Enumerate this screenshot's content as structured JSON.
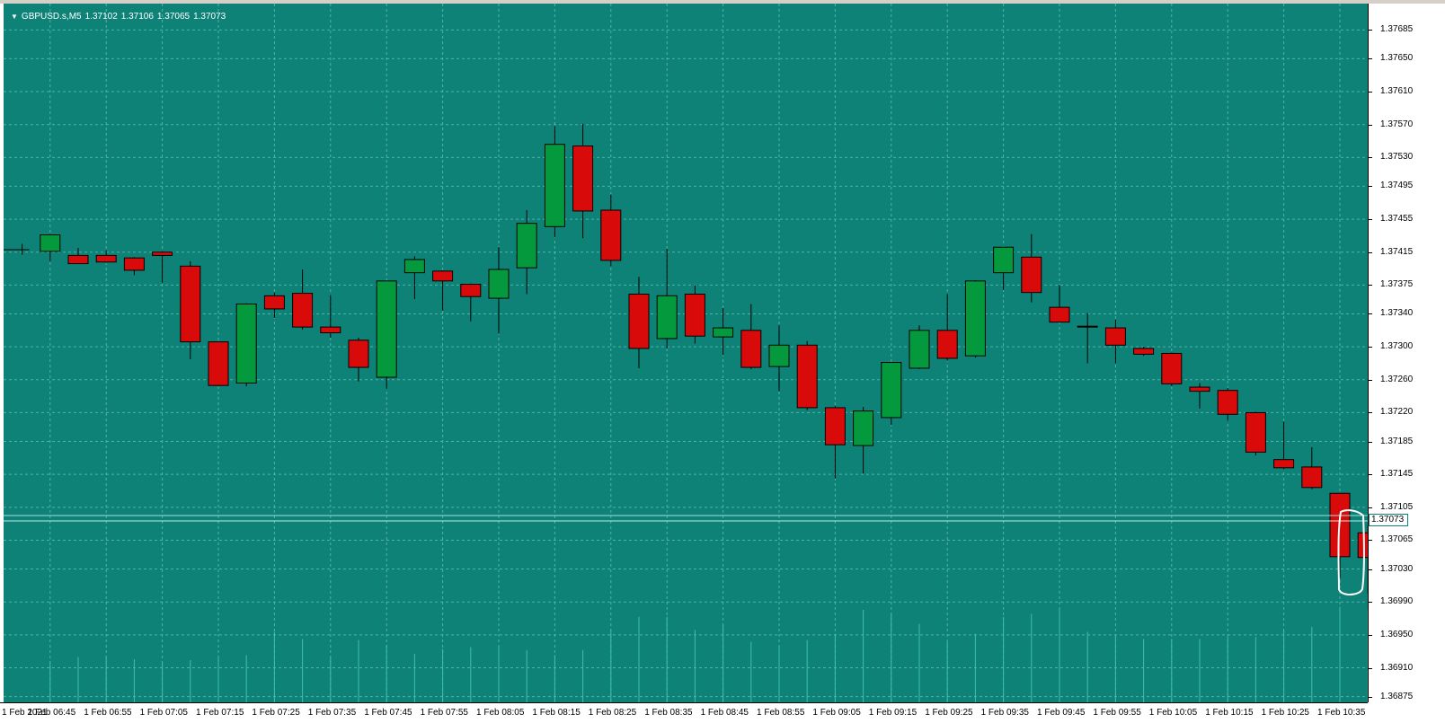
{
  "symbol_info": {
    "symbol": "GBPUSD.s,M5",
    "open": "1.37102",
    "high": "1.37106",
    "low": "1.37065",
    "close": "1.37073"
  },
  "current_price_label": "1.37073",
  "colors": {
    "background": "#0f8278",
    "bull": "#05993d",
    "bear": "#d80a0a",
    "grid": "#4fb3a8",
    "volume": "#3dbfb0"
  },
  "chart_data": {
    "type": "candlestick",
    "price_axis": [
      "1.37685",
      "1.37650",
      "1.37610",
      "1.37570",
      "1.37530",
      "1.37495",
      "1.37455",
      "1.37415",
      "1.37375",
      "1.37340",
      "1.37300",
      "1.37260",
      "1.37220",
      "1.37185",
      "1.37145",
      "1.37105",
      "1.37065",
      "1.37030",
      "1.36990",
      "1.36950",
      "1.36910",
      "1.36875"
    ],
    "time_axis": [
      "1 Feb 2021",
      "1 Feb 06:45",
      "1 Feb 06:55",
      "1 Feb 07:05",
      "1 Feb 07:15",
      "1 Feb 07:25",
      "1 Feb 07:35",
      "1 Feb 07:45",
      "1 Feb 07:55",
      "1 Feb 08:05",
      "1 Feb 08:15",
      "1 Feb 08:25",
      "1 Feb 08:35",
      "1 Feb 08:45",
      "1 Feb 08:55",
      "1 Feb 09:05",
      "1 Feb 09:15",
      "1 Feb 09:25",
      "1 Feb 09:35",
      "1 Feb 09:45",
      "1 Feb 09:55",
      "1 Feb 10:05",
      "1 Feb 10:15",
      "1 Feb 10:25",
      "1 Feb 10:35"
    ],
    "ylim": [
      1.36868,
      1.37717
    ],
    "timeframe": "M5",
    "candles": [
      {
        "o": 1.37418,
        "h": 1.37425,
        "l": 1.37412,
        "c": 1.37418
      },
      {
        "o": 1.37416,
        "h": 1.37437,
        "l": 1.37404,
        "c": 1.37436
      },
      {
        "o": 1.37411,
        "h": 1.3742,
        "l": 1.37402,
        "c": 1.37401
      },
      {
        "o": 1.37411,
        "h": 1.37417,
        "l": 1.37402,
        "c": 1.37403
      },
      {
        "o": 1.37408,
        "h": 1.37409,
        "l": 1.37387,
        "c": 1.37393
      },
      {
        "o": 1.37415,
        "h": 1.37416,
        "l": 1.37378,
        "c": 1.37411
      },
      {
        "o": 1.37398,
        "h": 1.37404,
        "l": 1.37285,
        "c": 1.37306
      },
      {
        "o": 1.37306,
        "h": 1.37306,
        "l": 1.37252,
        "c": 1.37253
      },
      {
        "o": 1.37256,
        "h": 1.37353,
        "l": 1.37252,
        "c": 1.37352
      },
      {
        "o": 1.37362,
        "h": 1.37366,
        "l": 1.37335,
        "c": 1.37346
      },
      {
        "o": 1.37365,
        "h": 1.37394,
        "l": 1.37321,
        "c": 1.37324
      },
      {
        "o": 1.37324,
        "h": 1.37363,
        "l": 1.37311,
        "c": 1.37317
      },
      {
        "o": 1.37308,
        "h": 1.37311,
        "l": 1.37258,
        "c": 1.37275
      },
      {
        "o": 1.37263,
        "h": 1.3738,
        "l": 1.37249,
        "c": 1.3738
      },
      {
        "o": 1.3739,
        "h": 1.3741,
        "l": 1.37358,
        "c": 1.37406
      },
      {
        "o": 1.37392,
        "h": 1.37393,
        "l": 1.37344,
        "c": 1.3738
      },
      {
        "o": 1.37376,
        "h": 1.37377,
        "l": 1.37331,
        "c": 1.37361
      },
      {
        "o": 1.37359,
        "h": 1.37421,
        "l": 1.37316,
        "c": 1.37394
      },
      {
        "o": 1.37396,
        "h": 1.37466,
        "l": 1.37364,
        "c": 1.3745
      },
      {
        "o": 1.37446,
        "h": 1.37568,
        "l": 1.37433,
        "c": 1.37546
      },
      {
        "o": 1.37544,
        "h": 1.37571,
        "l": 1.37432,
        "c": 1.37465
      },
      {
        "o": 1.37466,
        "h": 1.37485,
        "l": 1.37398,
        "c": 1.37405
      },
      {
        "o": 1.37364,
        "h": 1.37385,
        "l": 1.37274,
        "c": 1.37298
      },
      {
        "o": 1.3731,
        "h": 1.37419,
        "l": 1.37298,
        "c": 1.37362
      },
      {
        "o": 1.37364,
        "h": 1.37375,
        "l": 1.37304,
        "c": 1.37313
      },
      {
        "o": 1.37312,
        "h": 1.37347,
        "l": 1.3729,
        "c": 1.37323
      },
      {
        "o": 1.3732,
        "h": 1.37352,
        "l": 1.37273,
        "c": 1.37275
      },
      {
        "o": 1.37276,
        "h": 1.37326,
        "l": 1.37246,
        "c": 1.37302
      },
      {
        "o": 1.37302,
        "h": 1.37307,
        "l": 1.37223,
        "c": 1.37226
      },
      {
        "o": 1.37226,
        "h": 1.37228,
        "l": 1.3714,
        "c": 1.37181
      },
      {
        "o": 1.3718,
        "h": 1.37227,
        "l": 1.37146,
        "c": 1.37222
      },
      {
        "o": 1.37214,
        "h": 1.37281,
        "l": 1.37205,
        "c": 1.37281
      },
      {
        "o": 1.37274,
        "h": 1.37326,
        "l": 1.37273,
        "c": 1.3732
      },
      {
        "o": 1.3732,
        "h": 1.37364,
        "l": 1.37283,
        "c": 1.37286
      },
      {
        "o": 1.37289,
        "h": 1.37381,
        "l": 1.37287,
        "c": 1.3738
      },
      {
        "o": 1.3739,
        "h": 1.37421,
        "l": 1.37369,
        "c": 1.37421
      },
      {
        "o": 1.37409,
        "h": 1.37437,
        "l": 1.37354,
        "c": 1.37366
      },
      {
        "o": 1.37348,
        "h": 1.37375,
        "l": 1.3733,
        "c": 1.3733
      },
      {
        "o": 1.37324,
        "h": 1.37341,
        "l": 1.3728,
        "c": 1.37325
      },
      {
        "o": 1.37323,
        "h": 1.37333,
        "l": 1.3728,
        "c": 1.37302
      },
      {
        "o": 1.37298,
        "h": 1.373,
        "l": 1.37289,
        "c": 1.37291
      },
      {
        "o": 1.37292,
        "h": 1.37293,
        "l": 1.37252,
        "c": 1.37255
      },
      {
        "o": 1.37251,
        "h": 1.37256,
        "l": 1.37225,
        "c": 1.37246
      },
      {
        "o": 1.37247,
        "h": 1.3725,
        "l": 1.3721,
        "c": 1.37218
      },
      {
        "o": 1.3722,
        "h": 1.37221,
        "l": 1.37168,
        "c": 1.37172
      },
      {
        "o": 1.37163,
        "h": 1.37209,
        "l": 1.37151,
        "c": 1.37153
      },
      {
        "o": 1.37154,
        "h": 1.37178,
        "l": 1.37127,
        "c": 1.37129
      },
      {
        "o": 1.37122,
        "h": 1.37122,
        "l": 1.37019,
        "c": 1.37045
      },
      {
        "o": 1.37074,
        "h": 1.37083,
        "l": 1.37,
        "c": 1.37044
      }
    ],
    "volumes": [
      0.4,
      0.45,
      0.45,
      0.43,
      0.4,
      0.42,
      0.45,
      0.47,
      0.7,
      0.63,
      0.45,
      0.62,
      0.57,
      0.48,
      0.53,
      0.55,
      0.55,
      0.52,
      0.47,
      0.52,
      0.72,
      0.85,
      0.85,
      0.72,
      0.77,
      0.6,
      0.57,
      0.62,
      0.68,
      0.92,
      0.88,
      0.78,
      0.6,
      0.68,
      0.85,
      0.88,
      0.92,
      0.7,
      0.66,
      0.63,
      0.63,
      0.63,
      0.65,
      0.65,
      0.72,
      0.75,
      0.95,
      0.92,
      0.65
    ]
  }
}
